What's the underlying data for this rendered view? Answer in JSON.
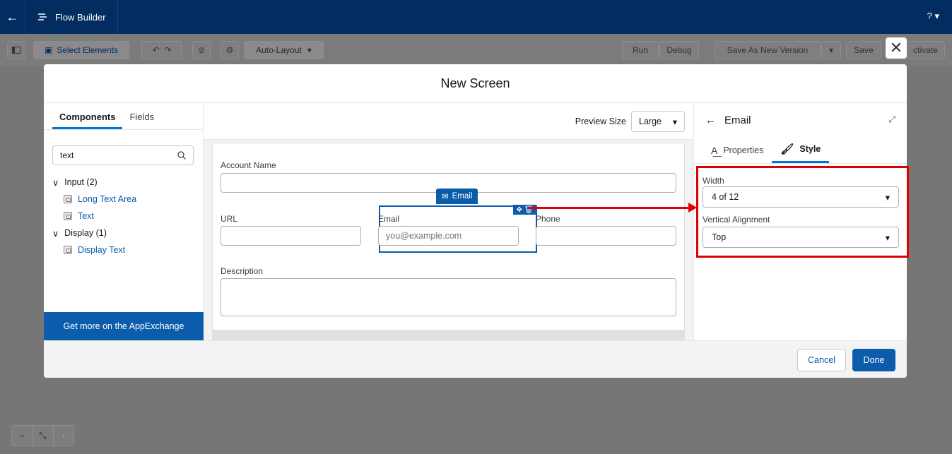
{
  "topbar": {
    "back_icon": "←",
    "app_title": "Flow Builder",
    "help": "? ▾"
  },
  "toolbar": {
    "select_elements": "Select Elements",
    "auto_layout": "Auto-Layout",
    "run": "Run",
    "debug": "Debug",
    "save_as_new_version": "Save As New Version",
    "save": "Save",
    "activate": "ctivate"
  },
  "modal": {
    "title": "New Screen",
    "close": "✕",
    "left": {
      "tab_components": "Components",
      "tab_fields": "Fields",
      "search_value": "text",
      "groups": [
        {
          "label": "Input (2)",
          "items": [
            "Long Text Area",
            "Text"
          ]
        },
        {
          "label": "Display (1)",
          "items": [
            "Display Text"
          ]
        }
      ],
      "appexchange": "Get more on the AppExchange"
    },
    "center": {
      "preview_size_label": "Preview Size",
      "preview_size_value": "Large",
      "fields": {
        "account_name": "Account Name",
        "url": "URL",
        "email": "Email",
        "email_placeholder": "you@example.com",
        "phone": "Phone",
        "description": "Description"
      },
      "email_tag": "Email"
    },
    "right": {
      "title": "Email",
      "tab_properties": "Properties",
      "tab_style": "Style",
      "width_label": "Width",
      "width_value": "4 of 12",
      "vertical_alignment_label": "Vertical Alignment",
      "vertical_alignment_value": "Top"
    },
    "footer": {
      "cancel": "Cancel",
      "done": "Done"
    }
  },
  "zoom": {
    "minus": "−",
    "fit": "⤡",
    "plus": "+"
  },
  "colors": {
    "brand": "#0b5cab",
    "header": "#032d60",
    "highlight": "#e00000"
  }
}
